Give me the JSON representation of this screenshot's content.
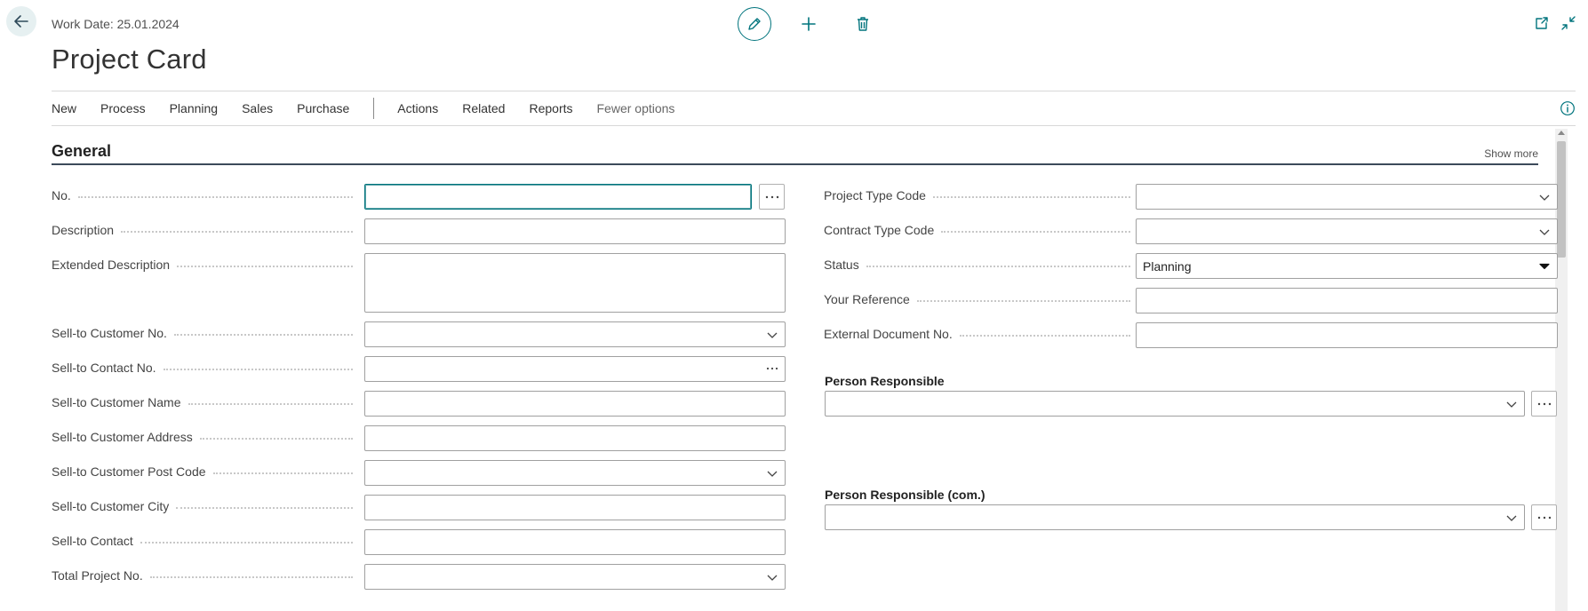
{
  "header": {
    "work_date": "Work Date: 25.01.2024",
    "page_title": "Project Card"
  },
  "action_bar": {
    "primary": [
      "New",
      "Process",
      "Planning",
      "Sales",
      "Purchase"
    ],
    "secondary": [
      "Actions",
      "Related",
      "Reports"
    ],
    "fewer_options": "Fewer options"
  },
  "section": {
    "title": "General",
    "show_more": "Show more"
  },
  "left_fields": {
    "no": {
      "label": "No.",
      "value": ""
    },
    "description": {
      "label": "Description",
      "value": ""
    },
    "extended_description": {
      "label": "Extended Description",
      "value": ""
    },
    "sell_to_customer_no": {
      "label": "Sell-to Customer No.",
      "value": ""
    },
    "sell_to_contact_no": {
      "label": "Sell-to Contact No.",
      "value": ""
    },
    "sell_to_customer_name": {
      "label": "Sell-to Customer Name",
      "value": ""
    },
    "sell_to_customer_address": {
      "label": "Sell-to Customer Address",
      "value": ""
    },
    "sell_to_customer_post_code": {
      "label": "Sell-to Customer Post Code",
      "value": ""
    },
    "sell_to_customer_city": {
      "label": "Sell-to Customer City",
      "value": ""
    },
    "sell_to_contact": {
      "label": "Sell-to Contact",
      "value": ""
    },
    "total_project_no": {
      "label": "Total Project No.",
      "value": ""
    }
  },
  "right_fields": {
    "project_type_code": {
      "label": "Project Type Code",
      "value": ""
    },
    "contract_type_code": {
      "label": "Contract Type Code",
      "value": ""
    },
    "status": {
      "label": "Status",
      "value": "Planning"
    },
    "your_reference": {
      "label": "Your Reference",
      "value": ""
    },
    "external_document_no": {
      "label": "External Document No.",
      "value": ""
    },
    "person_responsible": {
      "label": "Person Responsible",
      "value": ""
    },
    "person_responsible_com": {
      "label": "Person Responsible (com.)",
      "value": ""
    }
  },
  "icons": {
    "back": "arrow-left-icon",
    "edit": "pencil-icon",
    "new": "plus-icon",
    "delete": "trash-icon",
    "open_new_window": "open-in-new-window-icon",
    "collapse": "collapse-icon",
    "info": "info-icon",
    "dropdown": "chevron-down-icon",
    "lookup": "ellipsis-icon"
  },
  "colors": {
    "accent": "#00747d",
    "border": "#a0a0a0",
    "section_rule": "#3c4a5a"
  }
}
